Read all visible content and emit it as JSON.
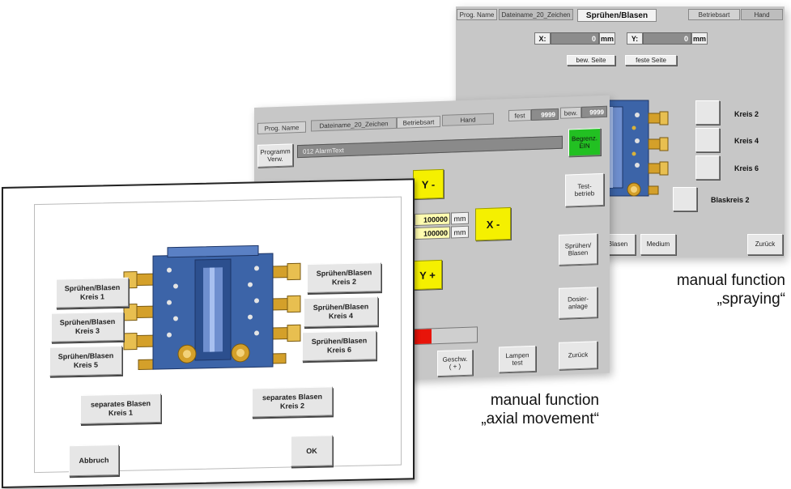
{
  "spray_screen": {
    "header": {
      "prog_name": "Prog. Name",
      "file_name": "Dateiname_20_Zeichen",
      "title": "Sprühen/Blasen",
      "mode_label": "Betriebsart",
      "mode_value": "Hand"
    },
    "x_label": "X:",
    "x_value": "0",
    "y_label": "Y:",
    "y_value": "0",
    "unit": "mm",
    "side_moving": "bew. Seite",
    "side_fixed": "feste Seite",
    "circuits": [
      {
        "label": "Kreis 2"
      },
      {
        "label": "Kreis 4"
      },
      {
        "label": "Kreis 6"
      }
    ],
    "blow_circuit": "Blaskreis 2",
    "bottom_blow": "Blasen",
    "bottom_medium": "Medium",
    "bottom_back": "Zurück"
  },
  "axial_screen": {
    "header": {
      "prog_name": "Prog. Name",
      "file_name": "Dateiname_20_Zeichen",
      "mode_label": "Betriebsart",
      "mode_value": "Hand",
      "fixed_label": "fest",
      "fixed_value": "9999",
      "moving_label": "bew.",
      "moving_value": "9999"
    },
    "prog_mgmt": "Programm\nVerw.",
    "alarm_text": "012   AlarmText",
    "limit_btn": "Begrenz.\nEIN",
    "y_minus": "Y -",
    "y_plus": "Y +",
    "x_minus": "X -",
    "pos1_value": "100000",
    "pos2_value": "100000",
    "unit": "mm",
    "test_mode": "Test-\nbetrieb",
    "spray_blow": "Sprühen/\nBlasen",
    "dosing": "Dosier-\nanlage",
    "speed": "Geschw.\n( + )",
    "lamp_test": "Lampen\ntest",
    "back": "Zurück"
  },
  "dialog": {
    "left_buttons": [
      {
        "label": "Sprühen/Blasen\nKreis 1"
      },
      {
        "label": "Sprühen/Blasen\nKreis 3"
      },
      {
        "label": "Sprühen/Blasen\nKreis 5"
      }
    ],
    "right_buttons": [
      {
        "label": "Sprühen/Blasen\nKreis 2"
      },
      {
        "label": "Sprühen/Blasen\nKreis 4"
      },
      {
        "label": "Sprühen/Blasen\nKreis 6"
      }
    ],
    "separate_1": "separates Blasen\nKreis 1",
    "separate_2": "separates Blasen\nKreis 2",
    "cancel": "Abbruch",
    "ok": "OK"
  },
  "captions": {
    "spraying_1": "manual function",
    "spraying_2": "„spraying“",
    "axial_1": "manual function",
    "axial_2": "„axial movement“"
  },
  "colors": {
    "panel_gray": "#c7c7c7",
    "mold_blue": "#3c64a8",
    "brass": "#d4a02a",
    "yellow": "#f5f000",
    "green": "#22c022",
    "red": "#e8140a"
  }
}
